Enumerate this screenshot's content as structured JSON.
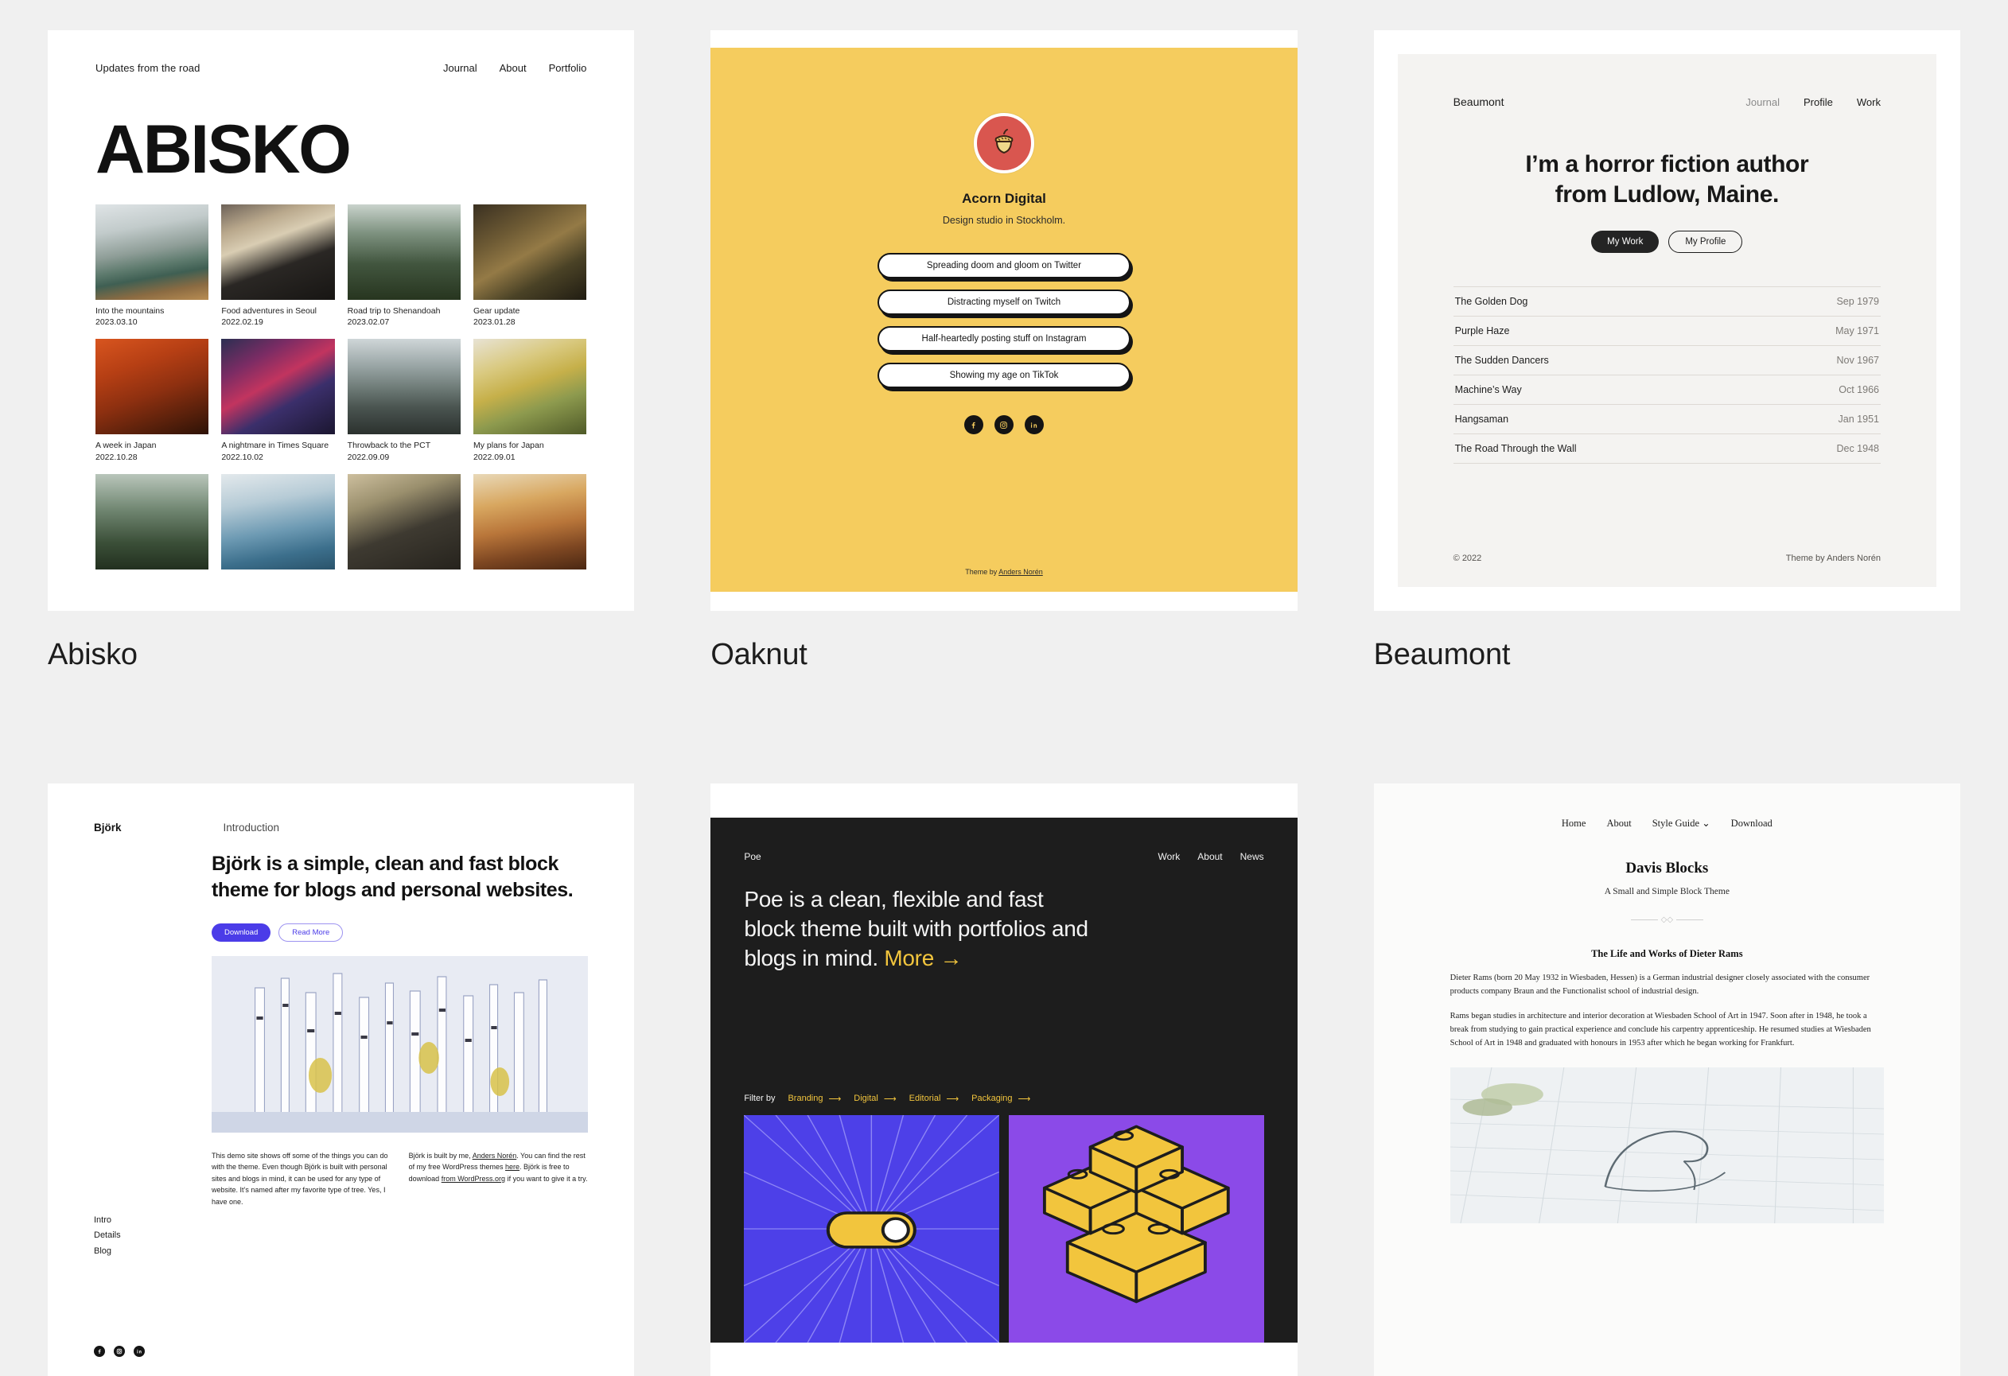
{
  "themes": [
    {
      "name": "Abisko"
    },
    {
      "name": "Oaknut"
    },
    {
      "name": "Beaumont"
    },
    {
      "name": "Björk"
    },
    {
      "name": "Poe"
    },
    {
      "name": "Davis Blocks"
    }
  ],
  "abisko": {
    "site_tagline": "Updates from the road",
    "nav": [
      "Journal",
      "About",
      "Portfolio"
    ],
    "title": "ABISKO",
    "posts": [
      {
        "caption": "Into the mountains",
        "date": "2023.03.10"
      },
      {
        "caption": "Food adventures in Seoul",
        "date": "2022.02.19"
      },
      {
        "caption": "Road trip to Shenandoah",
        "date": "2023.02.07"
      },
      {
        "caption": "Gear update",
        "date": "2023.01.28"
      },
      {
        "caption": "A week in Japan",
        "date": "2022.10.28"
      },
      {
        "caption": "A nightmare in Times Square",
        "date": "2022.10.02"
      },
      {
        "caption": "Throwback to the PCT",
        "date": "2022.09.09"
      },
      {
        "caption": "My plans for Japan",
        "date": "2022.09.01"
      }
    ]
  },
  "oaknut": {
    "brand": "Acorn Digital",
    "tagline": "Design studio in Stockholm.",
    "links": [
      "Spreading doom and gloom on Twitter",
      "Distracting myself on Twitch",
      "Half-heartedly posting stuff on Instagram",
      "Showing my age on TikTok"
    ],
    "socials": [
      "facebook-icon",
      "instagram-icon",
      "linkedin-icon"
    ],
    "footer_prefix": "Theme by ",
    "footer_author": "Anders Norén",
    "bg_color": "#f5cc5e",
    "logo_color": "#d9564f"
  },
  "beaumont": {
    "brand": "Beaumont",
    "nav": [
      "Journal",
      "Profile",
      "Work"
    ],
    "headline_line1": "I’m a horror fiction author",
    "headline_line2": "from Ludlow, Maine.",
    "primary_button": "My Work",
    "secondary_button": "My Profile",
    "books": [
      {
        "title": "The Golden Dog",
        "date": "Sep 1979"
      },
      {
        "title": "Purple Haze",
        "date": "May 1971"
      },
      {
        "title": "The Sudden Dancers",
        "date": "Nov 1967"
      },
      {
        "title": "Machine’s Way",
        "date": "Oct 1966"
      },
      {
        "title": "Hangsaman",
        "date": "Jan 1951"
      },
      {
        "title": "The Road Through the Wall",
        "date": "Dec 1948"
      }
    ],
    "copyright": "© 2022",
    "theme_credit": "Theme by Anders Norén"
  },
  "bjork": {
    "brand": "Björk",
    "section_label": "Introduction",
    "headline": "Björk is a simple, clean and fast block theme for blogs and personal websites.",
    "primary_button": "Download",
    "secondary_button": "Read More",
    "sidenav": [
      "Intro",
      "Details",
      "Blog"
    ],
    "col1": "This demo site shows off some of the things you can do with the theme. Even though Björk is built with personal sites and blogs in mind, it can be used for any type of website. It’s named after my favorite type of tree. Yes, I have one.",
    "col2_a": "Björk is built by me, ",
    "col2_link1": "Anders Norén",
    "col2_b": ". You can find the rest of my free WordPress themes ",
    "col2_link2": "here",
    "col2_c": ". Björk is free to download ",
    "col2_link3": "from WordPress.org",
    "col2_d": " if you want to give it a try.",
    "accent": "#4b3ce8",
    "socials": [
      "facebook-icon",
      "instagram-icon",
      "linkedin-icon"
    ]
  },
  "poe": {
    "brand": "Poe",
    "nav": [
      "Work",
      "About",
      "News"
    ],
    "headline": "Poe is a clean, flexible and fast block theme built with portfolios and blogs in mind.",
    "headline_link": "More",
    "filter_label": "Filter by",
    "filters": [
      "Branding",
      "Digital",
      "Editorial",
      "Packaging"
    ],
    "accent": "#f2c53d",
    "bg": "#1d1d1d"
  },
  "davis": {
    "nav": [
      "Home",
      "About",
      "Style Guide",
      "Download"
    ],
    "title": "Davis Blocks",
    "subtitle": "A Small and Simple Block Theme",
    "article_title": "The Life and Works of Dieter Rams",
    "p1": "Dieter Rams (born 20 May 1932 in Wiesbaden, Hessen) is a German industrial designer closely associated with the consumer products company Braun and the Functionalist school of industrial design.",
    "p2": "Rams began studies in architecture and interior decoration at Wiesbaden School of Art in 1947. Soon after in 1948, he took a break from studying to gain practical experience and conclude his carpentry apprenticeship. He resumed studies at Wiesbaden School of Art in 1948 and graduated with honours in 1953 after which he began working for Frankfurt."
  }
}
